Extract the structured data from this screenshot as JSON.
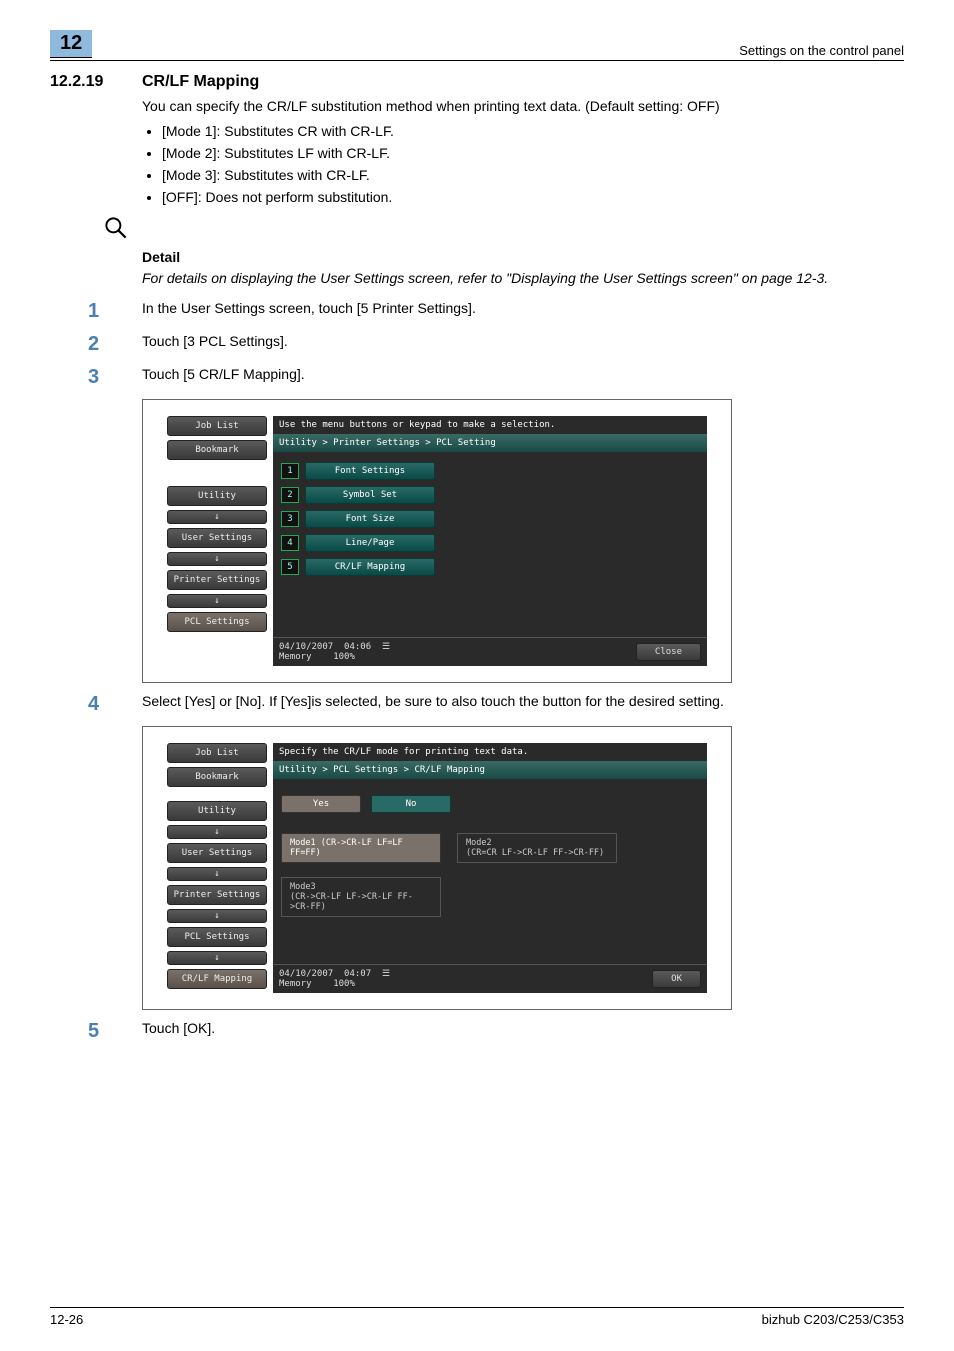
{
  "top": {
    "chapter_number": "12",
    "running_head": "Settings on the control panel"
  },
  "section": {
    "number": "12.2.19",
    "title": "CR/LF Mapping",
    "intro": "You can specify the CR/LF substitution method when printing text data. (Default setting: OFF)",
    "bullets": [
      "[Mode 1]: Substitutes CR with CR-LF.",
      "[Mode 2]: Substitutes LF with CR-LF.",
      "[Mode 3]: Substitutes with CR-LF.",
      "[OFF]: Does not perform substitution."
    ],
    "detail_head": "Detail",
    "detail_body": "For details on displaying the User Settings screen, refer to \"Displaying the User Settings screen\" on page 12-3."
  },
  "steps": [
    {
      "n": "1",
      "text": "In the User Settings screen, touch [5 Printer Settings]."
    },
    {
      "n": "2",
      "text": "Touch [3 PCL Settings]."
    },
    {
      "n": "3",
      "text": "Touch [5 CR/LF Mapping]."
    },
    {
      "n": "4",
      "text": "Select [Yes] or [No]. If [Yes]is selected, be sure to also touch the button for the desired setting."
    },
    {
      "n": "5",
      "text": "Touch [OK]."
    }
  ],
  "screenshot1": {
    "left": {
      "job_list": "Job List",
      "bookmark": "Bookmark",
      "utility": "Utility",
      "user_settings": "User Settings",
      "printer_settings": "Printer Settings",
      "pcl_settings": "PCL Settings",
      "arrow": "↓"
    },
    "header": "Use the menu buttons or keypad to make a selection.",
    "breadcrumb": "Utility > Printer Settings > PCL Setting",
    "menu": [
      {
        "n": "1",
        "label": "Font Settings"
      },
      {
        "n": "2",
        "label": "Symbol Set"
      },
      {
        "n": "3",
        "label": "Font Size"
      },
      {
        "n": "4",
        "label": "Line/Page"
      },
      {
        "n": "5",
        "label": "CR/LF Mapping"
      }
    ],
    "footer": {
      "date": "04/10/2007",
      "time": "04:06",
      "memory": "Memory",
      "memval": "100%",
      "close": "Close"
    }
  },
  "screenshot2": {
    "left": {
      "job_list": "Job List",
      "bookmark": "Bookmark",
      "utility": "Utility",
      "user_settings": "User Settings",
      "printer_settings": "Printer Settings",
      "pcl_settings": "PCL Settings",
      "crlf_mapping": "CR/LF Mapping",
      "arrow": "↓"
    },
    "header": "Specify the CR/LF mode for printing text data.",
    "breadcrumb": "Utility > PCL Settings > CR/LF Mapping",
    "yes": "Yes",
    "no": "No",
    "mode1_top": "Mode1 (CR->CR-LF LF=LF FF=FF)",
    "mode2_top": "Mode2",
    "mode2_bot": "(CR=CR LF->CR-LF FF->CR-FF)",
    "mode3_top": "Mode3",
    "mode3_bot": "(CR->CR-LF LF->CR-LF FF->CR-FF)",
    "footer": {
      "date": "04/10/2007",
      "time": "04:07",
      "memory": "Memory",
      "memval": "100%",
      "ok": "OK"
    }
  },
  "bottom": {
    "page": "12-26",
    "model": "bizhub C203/C253/C353"
  }
}
